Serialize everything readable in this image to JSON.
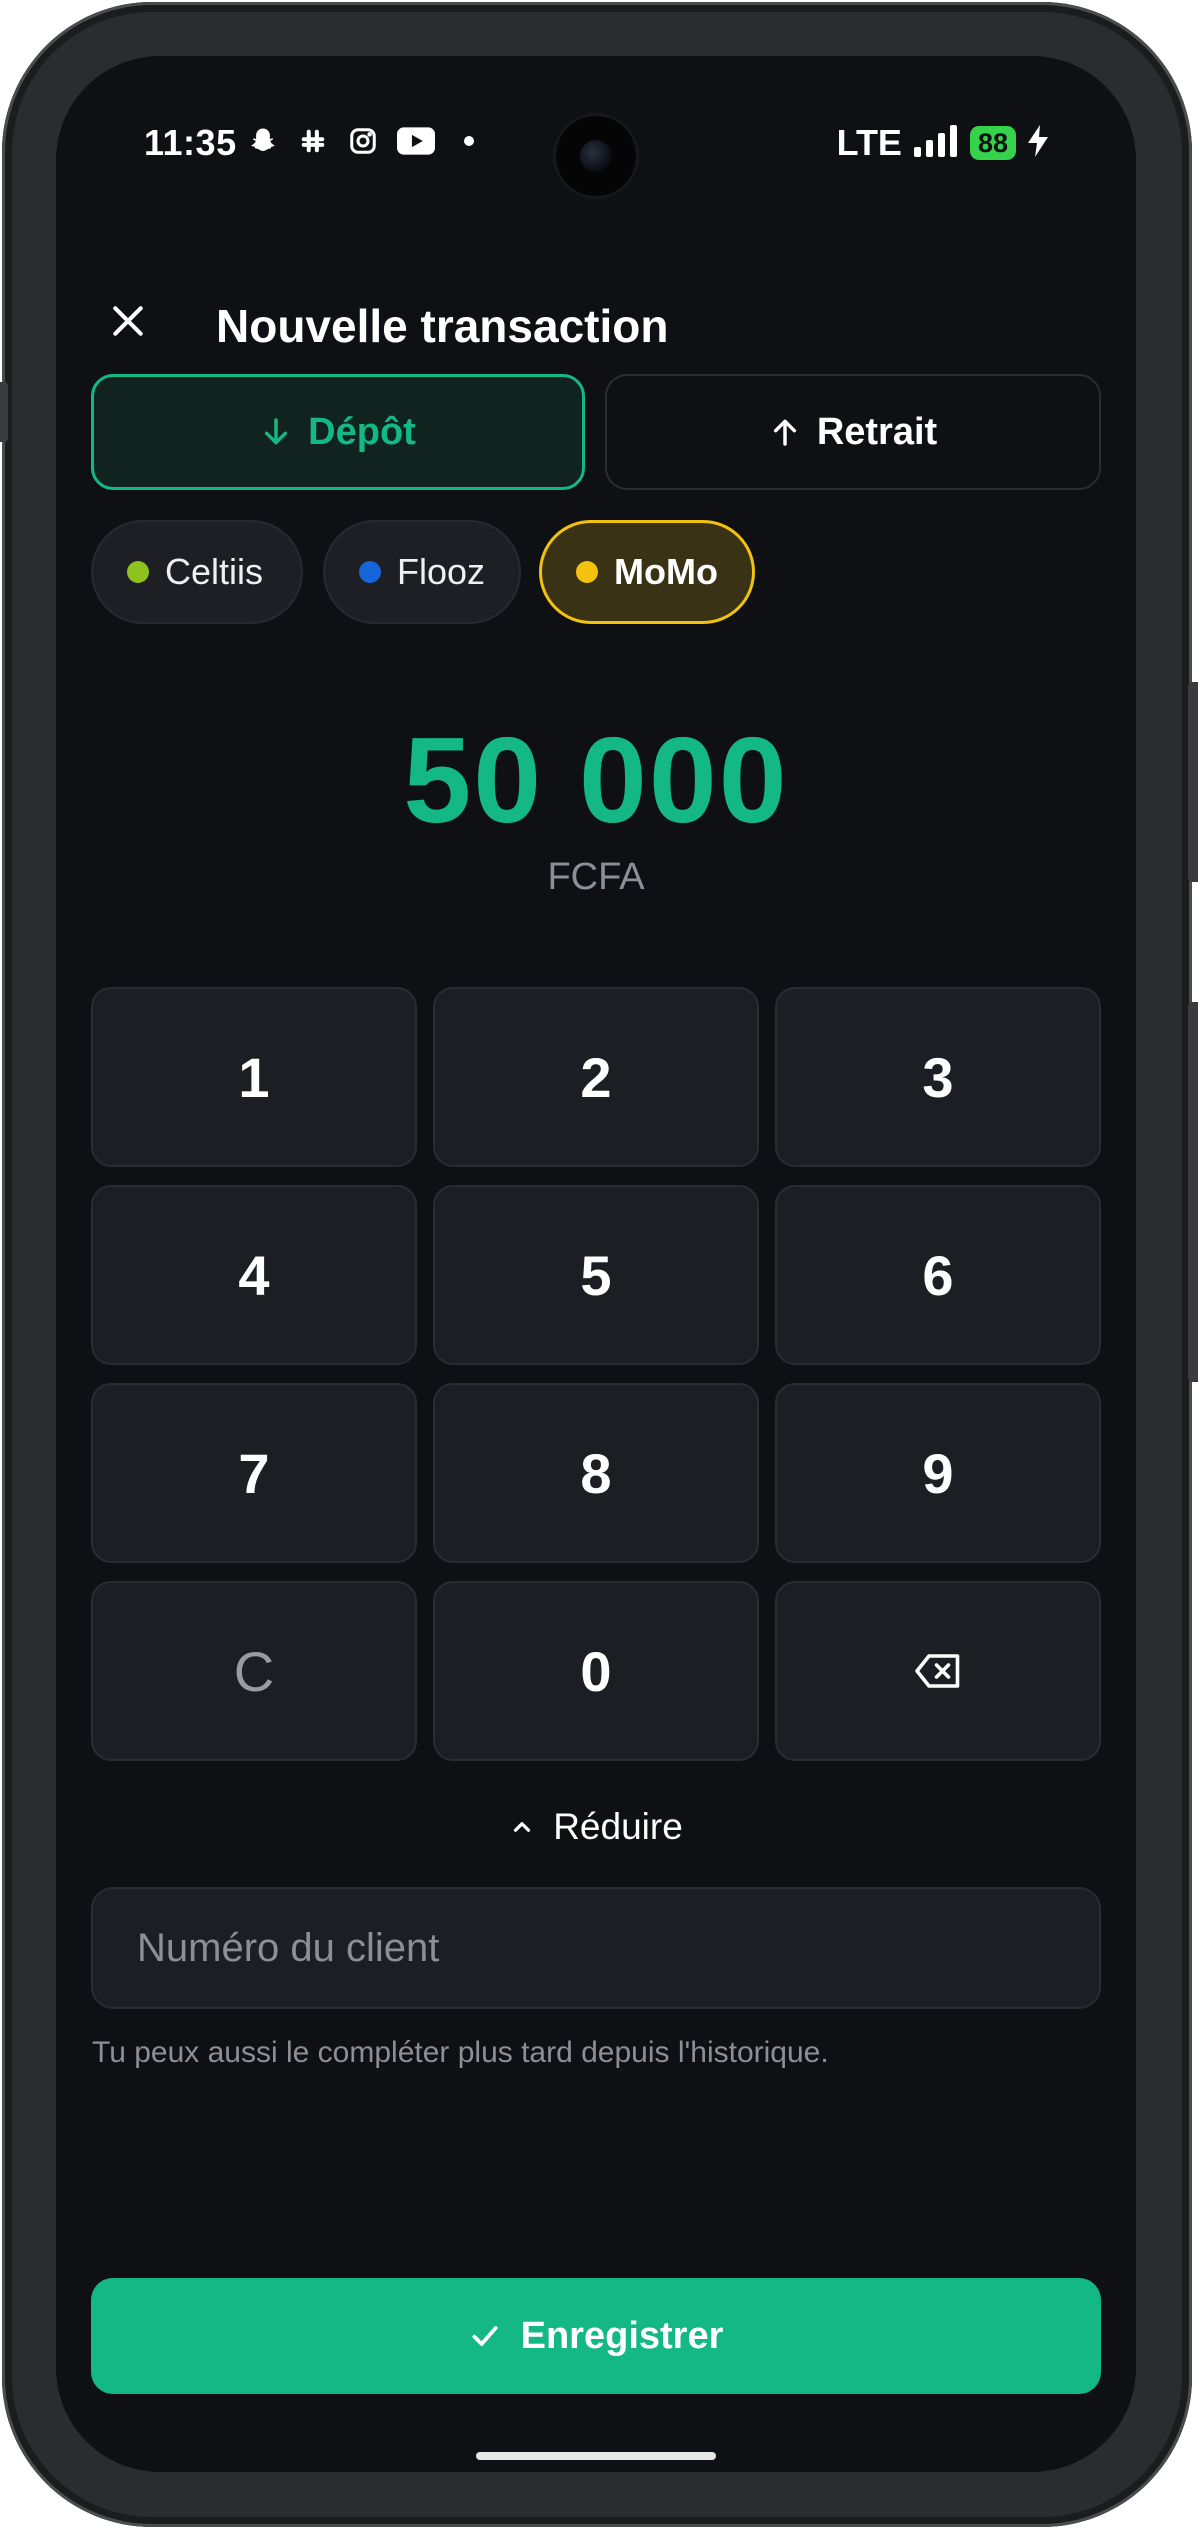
{
  "status_bar": {
    "time": "11:35",
    "network": "LTE",
    "battery": "88",
    "notification_icons": [
      "snapchat-icon",
      "slack-icon",
      "instagram-icon",
      "youtube-icon",
      "dot-icon"
    ]
  },
  "header": {
    "title": "Nouvelle transaction"
  },
  "type_toggle": {
    "deposit_label": "Dépôt",
    "withdraw_label": "Retrait",
    "selected": "deposit"
  },
  "operators": [
    {
      "label": "Celtiis",
      "color": "#8dc21f"
    },
    {
      "label": "Flooz",
      "color": "#1565d8"
    },
    {
      "label": "MoMo",
      "color": "#f2c20f"
    }
  ],
  "selected_operator": "MoMo",
  "amount": {
    "value": "50 000",
    "currency": "FCFA"
  },
  "keypad": {
    "keys": [
      "1",
      "2",
      "3",
      "4",
      "5",
      "6",
      "7",
      "8",
      "9",
      "C",
      "0"
    ],
    "backspace_icon": "backspace-icon"
  },
  "reduce_label": "Réduire",
  "client": {
    "placeholder": "Numéro du client",
    "hint": "Tu peux aussi le compléter plus tard depuis l'historique."
  },
  "submit_label": "Enregistrer",
  "colors": {
    "accent": "#14b885",
    "momo": "#f2c20f",
    "background": "#0f1013",
    "surface": "#1c1e24"
  }
}
